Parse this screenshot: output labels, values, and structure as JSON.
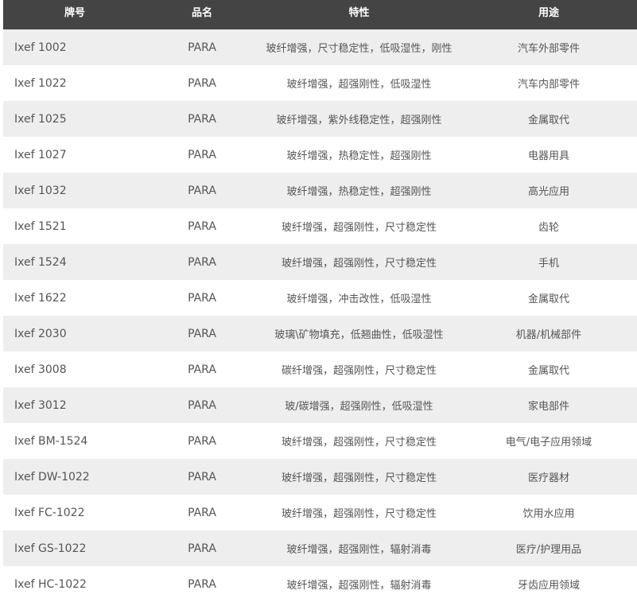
{
  "table": {
    "headers": [
      "牌号",
      "品名",
      "特性",
      "用途"
    ],
    "rows": [
      [
        "Ixef 1002",
        "PARA",
        "玻纤增强，尺寸稳定性，低吸湿性，刚性",
        "汽车外部零件"
      ],
      [
        "Ixef 1022",
        "PARA",
        "玻纤增强，超强刚性，低吸湿性",
        "汽车内部零件"
      ],
      [
        "Ixef 1025",
        "PARA",
        "玻纤增强，紫外线稳定性，超强刚性",
        "金属取代"
      ],
      [
        "Ixef 1027",
        "PARA",
        "玻纤增强，热稳定性，超强刚性",
        "电器用具"
      ],
      [
        "Ixef 1032",
        "PARA",
        "玻纤增强，热稳定性，超强刚性",
        "高光应用"
      ],
      [
        "Ixef 1521",
        "PARA",
        "玻纤增强，超强刚性，尺寸稳定性",
        "齿轮"
      ],
      [
        "Ixef 1524",
        "PARA",
        "玻纤增强，超强刚性，尺寸稳定性",
        "手机"
      ],
      [
        "Ixef 1622",
        "PARA",
        "玻纤增强，冲击改性，低吸湿性",
        "金属取代"
      ],
      [
        "Ixef 2030",
        "PARA",
        "玻璃\\矿物填充，低翘曲性，低吸湿性",
        "机器/机械部件"
      ],
      [
        "Ixef 3008",
        "PARA",
        "碳纤增强，超强刚性，尺寸稳定性",
        "金属取代"
      ],
      [
        "Ixef 3012",
        "PARA",
        "玻/碳增强，超强刚性，低吸湿性",
        "家电部件"
      ],
      [
        "Ixef BM-1524",
        "PARA",
        "玻纤增强，超强刚性，尺寸稳定性",
        "电气/电子应用领域"
      ],
      [
        "Ixef DW-1022",
        "PARA",
        "玻纤增强，超强刚性，尺寸稳定性",
        "医疗器材"
      ],
      [
        "Ixef FC-1022",
        "PARA",
        "玻纤增强，超强刚性，尺寸稳定性",
        "饮用水应用"
      ],
      [
        "Ixef GS-1022",
        "PARA",
        "玻纤增强，超强刚性，辐射消毒",
        "医疗/护理用品"
      ],
      [
        "Ixef HC-1022",
        "PARA",
        "玻纤增强，超强刚性，辐射消毒",
        "牙齿应用领域"
      ]
    ]
  }
}
